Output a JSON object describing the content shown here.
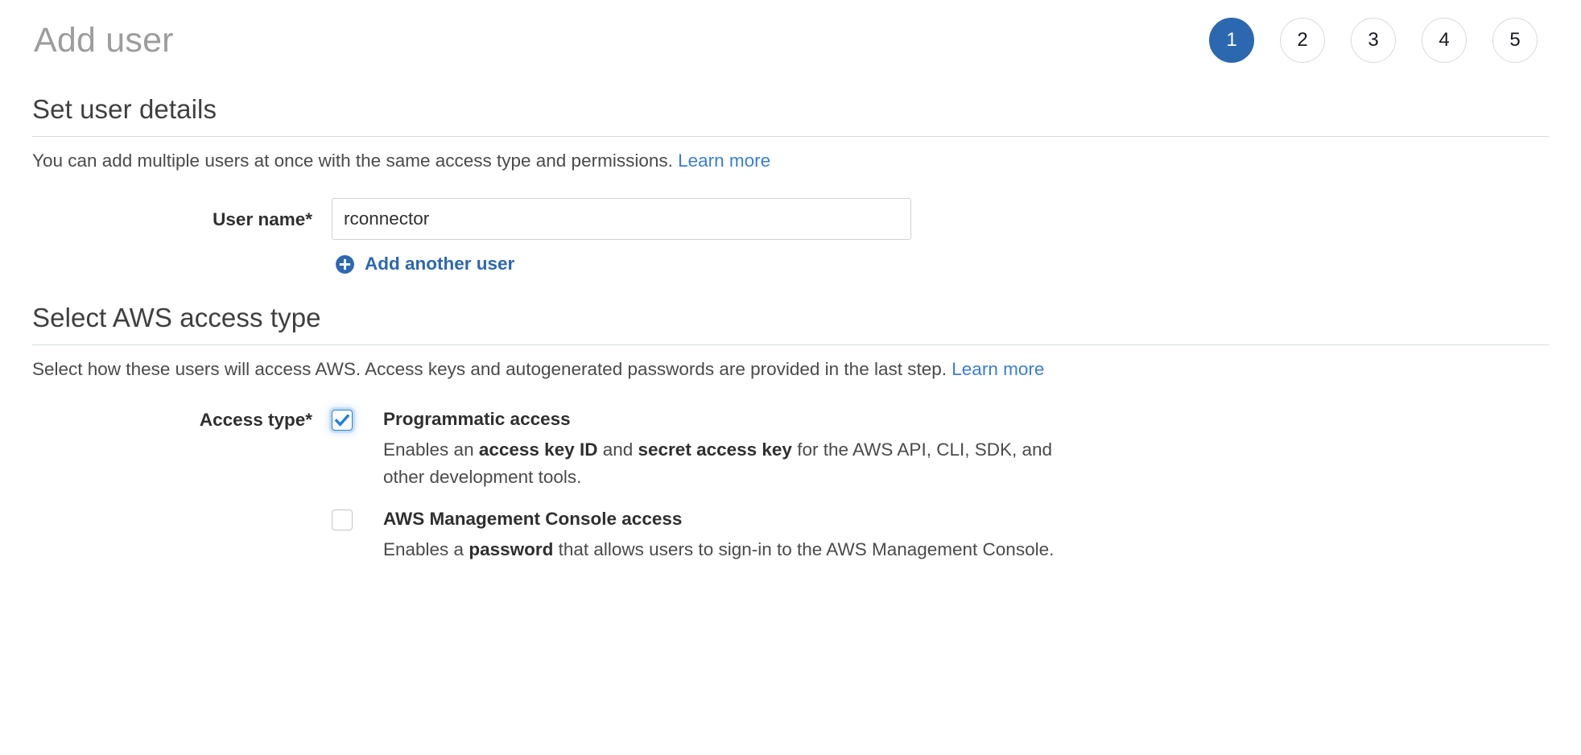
{
  "header": {
    "title": "Add user",
    "steps": [
      {
        "label": "1",
        "active": true
      },
      {
        "label": "2",
        "active": false
      },
      {
        "label": "3",
        "active": false
      },
      {
        "label": "4",
        "active": false
      },
      {
        "label": "5",
        "active": false
      }
    ],
    "active_step_color": "#2c68b0"
  },
  "user_details": {
    "heading": "Set user details",
    "description": "You can add multiple users at once with the same access type and permissions.",
    "learn_more": "Learn more",
    "username_label": "User name*",
    "username_value": "rconnector",
    "username_placeholder": "",
    "add_another_label": "Add another user",
    "add_another_icon": "plus-circle-icon"
  },
  "access_type": {
    "heading": "Select AWS access type",
    "description": "Select how these users will access AWS. Access keys and autogenerated passwords are provided in the last step.",
    "learn_more": "Learn more",
    "label": "Access type*",
    "options": [
      {
        "title": "Programmatic access",
        "checked": true,
        "desc_parts": [
          {
            "text": "Enables an ",
            "bold": false
          },
          {
            "text": "access key ID",
            "bold": true
          },
          {
            "text": " and ",
            "bold": false
          },
          {
            "text": "secret access key",
            "bold": true
          },
          {
            "text": " for the AWS API, CLI, SDK, and other development tools.",
            "bold": false
          }
        ]
      },
      {
        "title": "AWS Management Console access",
        "checked": false,
        "desc_parts": [
          {
            "text": "Enables a ",
            "bold": false
          },
          {
            "text": "password",
            "bold": true
          },
          {
            "text": " that allows users to sign-in to the AWS Management Console.",
            "bold": false
          }
        ]
      }
    ]
  },
  "colors": {
    "link": "#3b7dd8",
    "accent": "#2c68b0",
    "title_gray": "#9d9d9d",
    "divider": "#d5dbdb"
  }
}
